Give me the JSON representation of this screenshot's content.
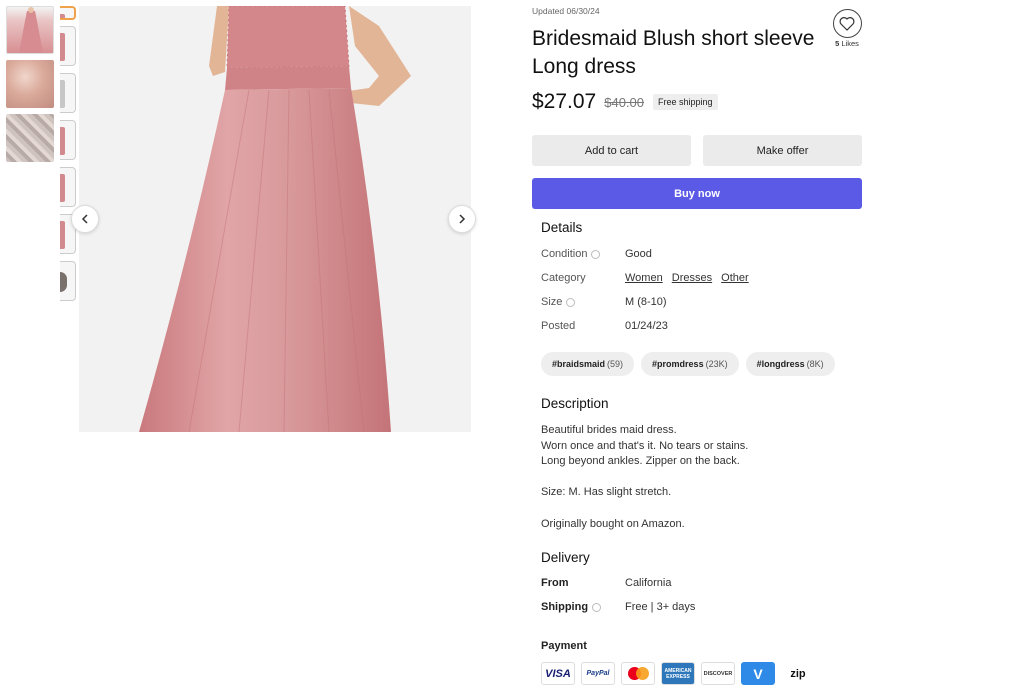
{
  "listing": {
    "updated": "Updated 06/30/24",
    "title": "Bridesmaid Blush short sleeve Long dress",
    "likes_count": "5",
    "likes_label": "Likes",
    "price": "$27.07",
    "original_price": "$40.00",
    "shipping_badge": "Free shipping"
  },
  "actions": {
    "add_to_cart": "Add to cart",
    "make_offer": "Make offer",
    "buy_now": "Buy now"
  },
  "details": {
    "heading": "Details",
    "condition_label": "Condition",
    "condition_value": "Good",
    "category_label": "Category",
    "categories": [
      "Women",
      "Dresses",
      "Other"
    ],
    "size_label": "Size",
    "size_value": "M (8-10)",
    "posted_label": "Posted",
    "posted_value": "01/24/23"
  },
  "tags": [
    {
      "name": "#braidsmaid",
      "count": "(59)"
    },
    {
      "name": "#promdress",
      "count": "(23K)"
    },
    {
      "name": "#longdress",
      "count": "(8K)"
    }
  ],
  "description": {
    "heading": "Description",
    "lines": [
      "Beautiful brides maid dress.",
      "Worn once and that's it. No tears or stains.",
      "Long beyond ankles. Zipper on the back.",
      "",
      "Size: M. Has slight stretch.",
      "",
      "Originally bought on Amazon."
    ]
  },
  "delivery": {
    "heading": "Delivery",
    "from_label": "From",
    "from_value": "California",
    "shipping_label": "Shipping",
    "shipping_value": "Free | 3+ days"
  },
  "payment": {
    "heading": "Payment",
    "methods": [
      "VISA",
      "PayPal",
      "MasterCard",
      "American Express",
      "DISCOVER",
      "V",
      "zip"
    ]
  },
  "colors": {
    "accent": "#5b5ae6",
    "dress": "#d8999b"
  }
}
